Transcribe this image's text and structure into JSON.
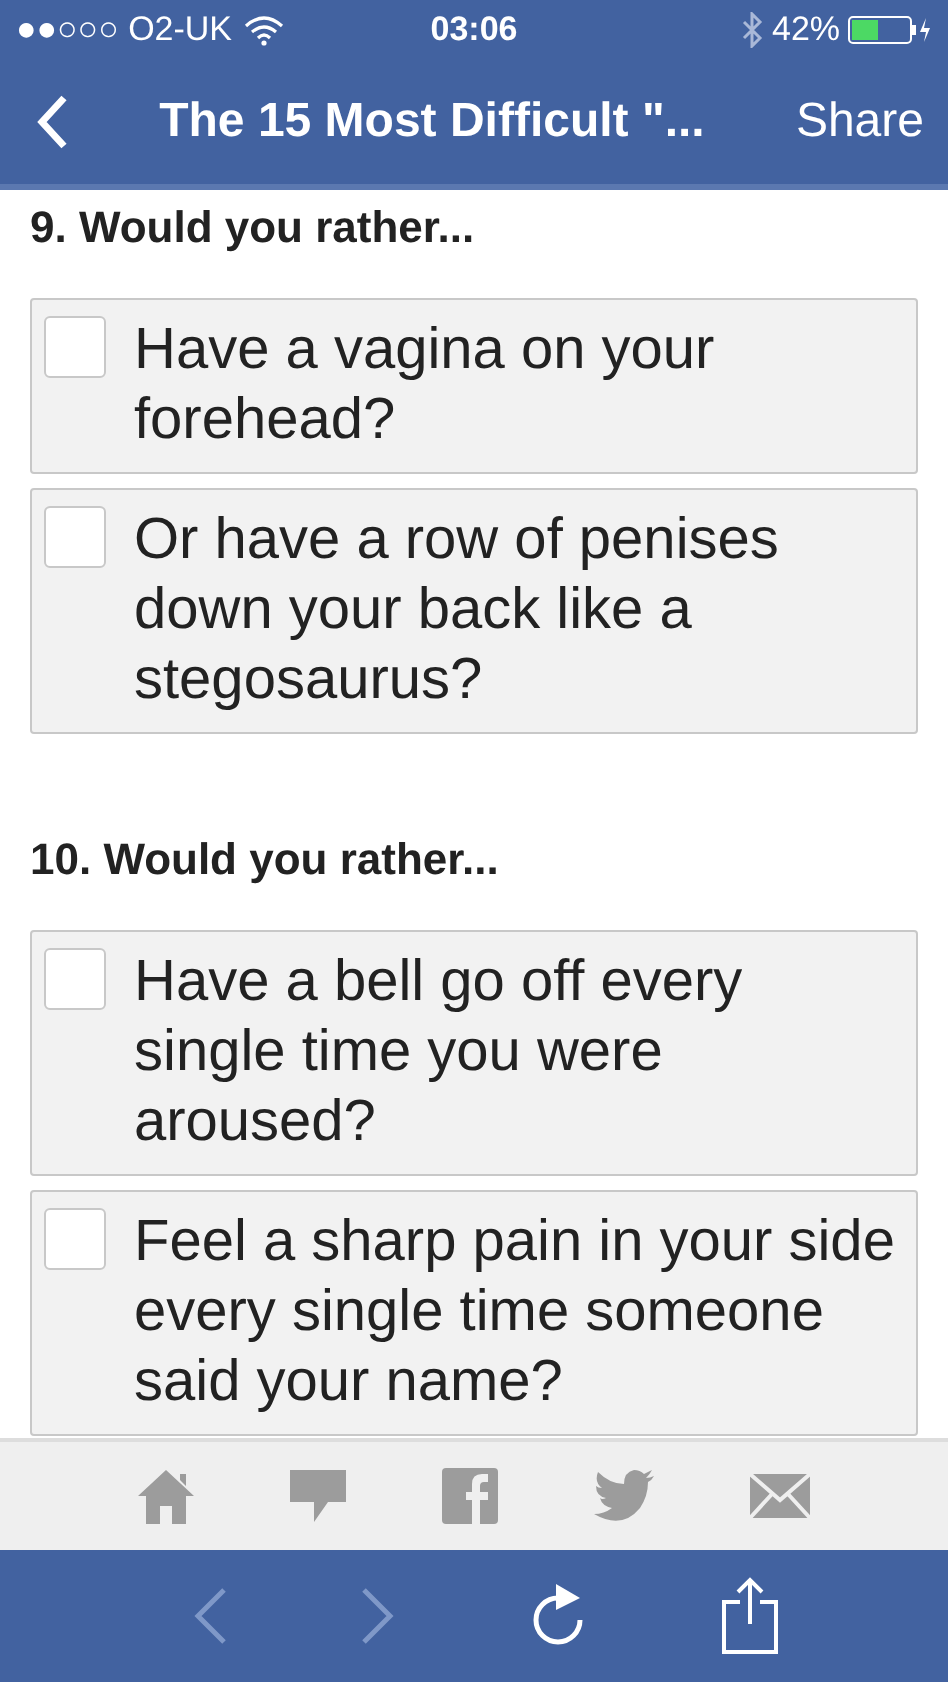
{
  "status_bar": {
    "carrier": "●●○○○ O2-UK",
    "time": "03:06",
    "battery": "42%"
  },
  "nav_bar": {
    "title": "The 15 Most Difficult \"...",
    "action": "Share"
  },
  "questions": [
    {
      "title": "9. Would you rather...",
      "options": [
        {
          "text": "Have a vagina on your forehead?",
          "checked": false
        },
        {
          "text": "Or have a row of penises down your back like a stegosaurus?",
          "checked": false
        }
      ]
    },
    {
      "title": "10. Would you rather...",
      "options": [
        {
          "text": "Have a bell go off every single time you were aroused?",
          "checked": false
        },
        {
          "text": "Feel a sharp pain in your side every single time someone said your name?",
          "checked": false
        }
      ]
    }
  ],
  "share_bar": [
    {
      "kind": "home"
    },
    {
      "kind": "comment"
    },
    {
      "kind": "facebook"
    },
    {
      "kind": "twitter"
    },
    {
      "kind": "mail"
    }
  ],
  "browser_toolbar": [
    {
      "kind": "back",
      "disabled": true
    },
    {
      "kind": "forward",
      "disabled": true
    },
    {
      "kind": "reload",
      "disabled": false
    },
    {
      "kind": "share",
      "disabled": false
    }
  ]
}
